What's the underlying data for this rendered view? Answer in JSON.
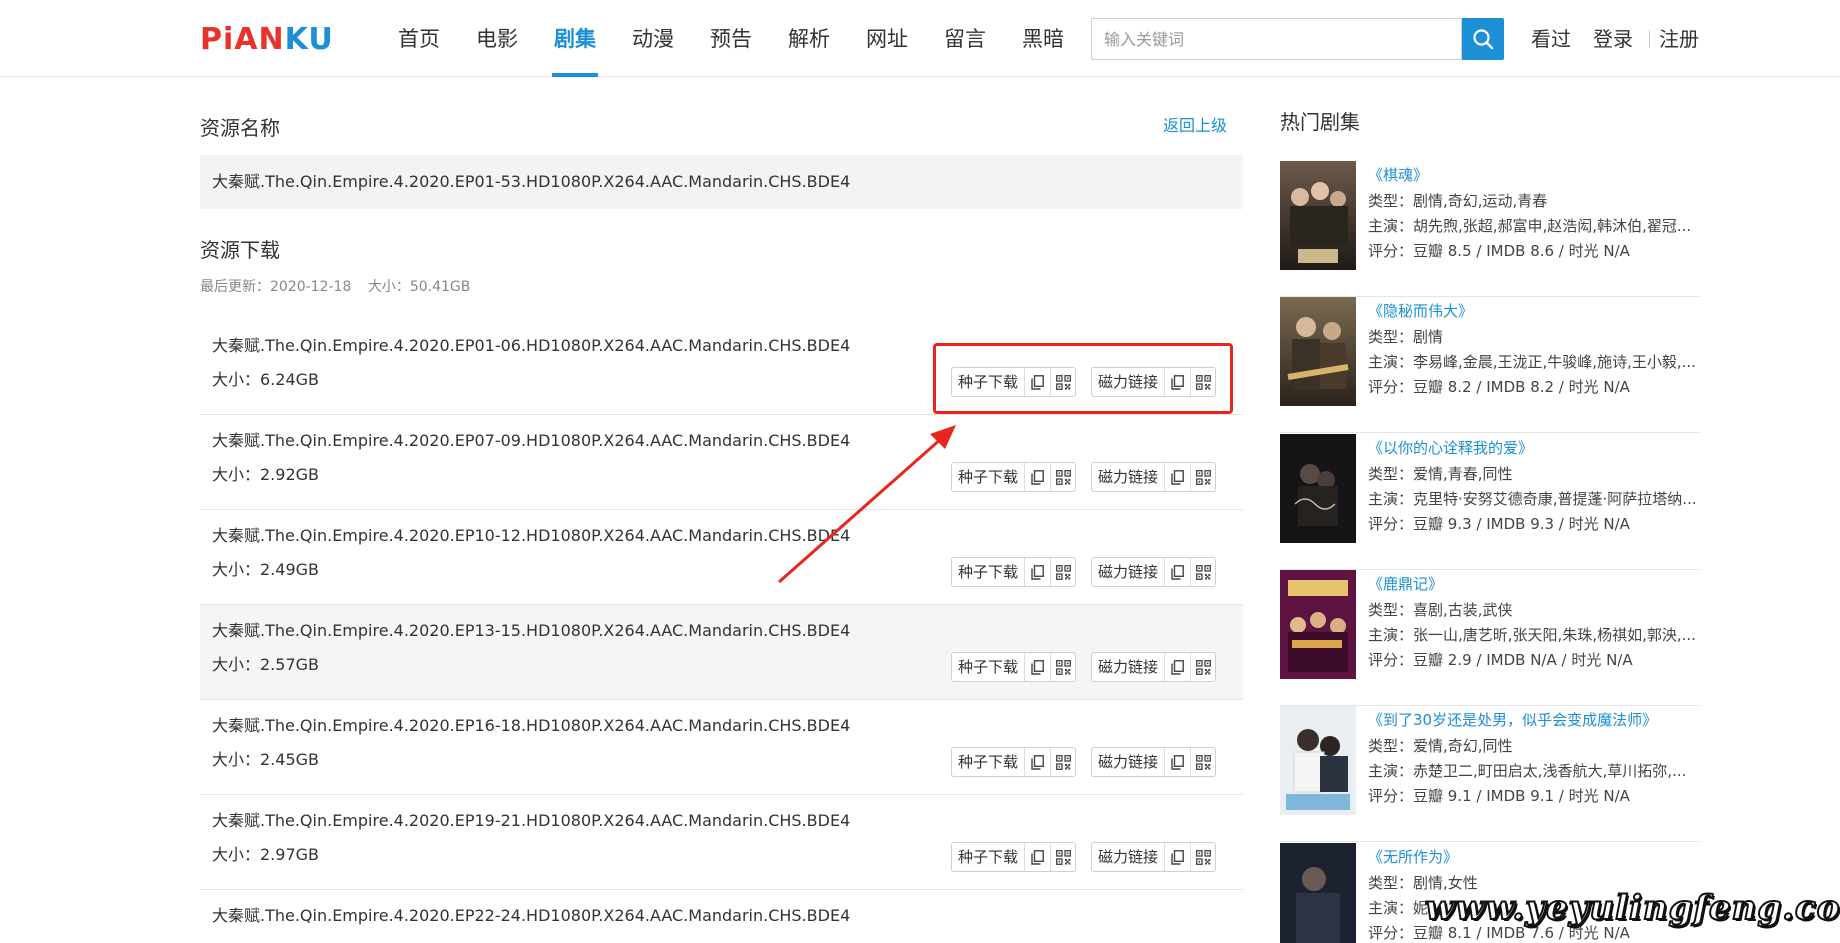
{
  "logo": {
    "part1": "PiAN",
    "part2": "KU"
  },
  "nav": [
    {
      "label": "首页",
      "active": false
    },
    {
      "label": "电影",
      "active": false
    },
    {
      "label": "剧集",
      "active": true
    },
    {
      "label": "动漫",
      "active": false
    },
    {
      "label": "预告",
      "active": false
    },
    {
      "label": "解析",
      "active": false
    },
    {
      "label": "网址",
      "active": false
    },
    {
      "label": "留言",
      "active": false
    },
    {
      "label": "黑暗",
      "active": false
    }
  ],
  "search": {
    "placeholder": "输入关键词",
    "value": ""
  },
  "header_links": {
    "history": "看过",
    "login": "登录",
    "register": "注册"
  },
  "resource": {
    "name_title": "资源名称",
    "back_label": "返回上级",
    "name": "大秦赋.The.Qin.Empire.4.2020.EP01-53.HD1080P.X264.AAC.Mandarin.CHS.BDE4",
    "download_title": "资源下载",
    "updated": "最后更新：2020-12-18",
    "size": "大小：50.41GB"
  },
  "downloads": [
    {
      "name": "大秦赋.The.Qin.Empire.4.2020.EP01-06.HD1080P.X264.AAC.Mandarin.CHS.BDE4",
      "size": "大小：6.24GB"
    },
    {
      "name": "大秦赋.The.Qin.Empire.4.2020.EP07-09.HD1080P.X264.AAC.Mandarin.CHS.BDE4",
      "size": "大小：2.92GB"
    },
    {
      "name": "大秦赋.The.Qin.Empire.4.2020.EP10-12.HD1080P.X264.AAC.Mandarin.CHS.BDE4",
      "size": "大小：2.49GB"
    },
    {
      "name": "大秦赋.The.Qin.Empire.4.2020.EP13-15.HD1080P.X264.AAC.Mandarin.CHS.BDE4",
      "size": "大小：2.57GB"
    },
    {
      "name": "大秦赋.The.Qin.Empire.4.2020.EP16-18.HD1080P.X264.AAC.Mandarin.CHS.BDE4",
      "size": "大小：2.45GB"
    },
    {
      "name": "大秦赋.The.Qin.Empire.4.2020.EP19-21.HD1080P.X264.AAC.Mandarin.CHS.BDE4",
      "size": "大小：2.97GB"
    },
    {
      "name": "大秦赋.The.Qin.Empire.4.2020.EP22-24.HD1080P.X264.AAC.Mandarin.CHS.BDE4",
      "size": ""
    }
  ],
  "buttons": {
    "torrent": "种子下载",
    "magnet": "磁力链接"
  },
  "sidebar": {
    "title": "热门剧集",
    "items": [
      {
        "title": "《棋魂》",
        "genre": "类型：剧情,奇幻,运动,青春",
        "cast": "主演：胡先煦,张超,郝富申,赵浩闳,韩沐伯,翟冠...",
        "rating": "评分：豆瓣 8.5 / IMDB 8.6 / 时光 N/A"
      },
      {
        "title": "《隐秘而伟大》",
        "genre": "类型：剧情",
        "cast": "主演：李易峰,金晨,王泷正,牛骏峰,施诗,王小毅,...",
        "rating": "评分：豆瓣 8.2 / IMDB 8.2 / 时光 N/A"
      },
      {
        "title": "《以你的心诠释我的爱》",
        "genre": "类型：爱情,青春,同性",
        "cast": "主演：克里特·安努艾德奇康,普提蓬·阿萨拉塔纳...",
        "rating": "评分：豆瓣 9.3 / IMDB 9.3 / 时光 N/A"
      },
      {
        "title": "《鹿鼎记》",
        "genre": "类型：喜剧,古装,武侠",
        "cast": "主演：张一山,唐艺昕,张天阳,朱珠,杨祺如,郭泱,...",
        "rating": "评分：豆瓣 2.9 / IMDB N/A / 时光 N/A"
      },
      {
        "title": "《到了30岁还是处男，似乎会变成魔法师》",
        "genre": "类型：爱情,奇幻,同性",
        "cast": "主演：赤楚卫二,町田启太,浅香航大,草川拓弥,...",
        "rating": "评分：豆瓣 9.1 / IMDB 9.1 / 时光 N/A"
      },
      {
        "title": "《无所作为》",
        "genre": "类型：剧情,女性",
        "cast": "主演：妮...",
        "rating": "评分：豆瓣 8.1 / IMDB 7.6 / 时光 N/A"
      }
    ]
  },
  "watermark": "www.yeyulingfeng.com",
  "colors": {
    "accent": "#1c8fd6",
    "logo_red": "#e8322b",
    "annotation": "#e8261d"
  }
}
